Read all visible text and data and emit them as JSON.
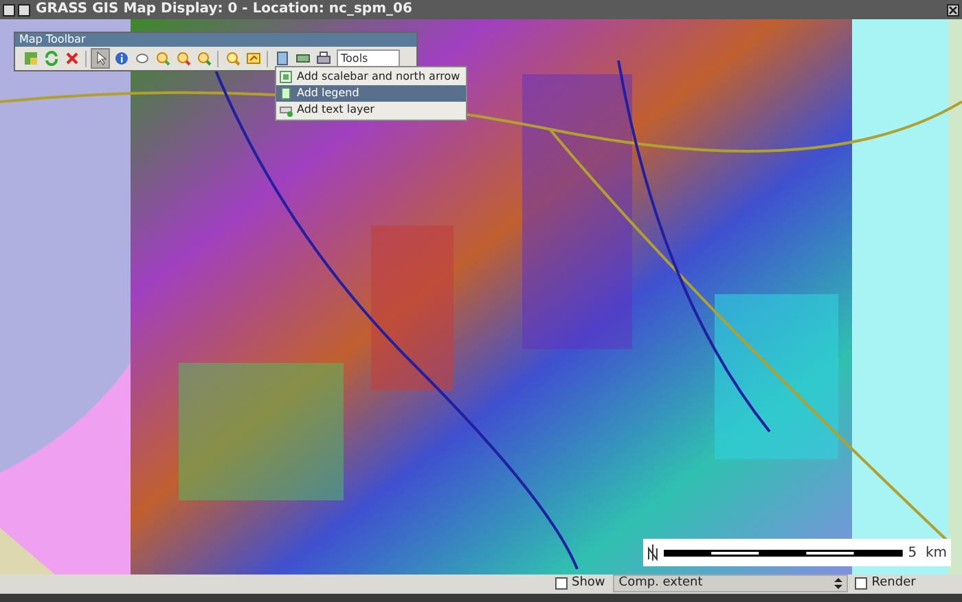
{
  "window": {
    "title": "GRASS GIS Map Display: 0 - Location: nc_spm_06"
  },
  "toolbar": {
    "title": "Map Toolbar",
    "tools": [
      {
        "kind": "add-map",
        "selected": false
      },
      {
        "kind": "rerender",
        "selected": false
      },
      {
        "kind": "erase",
        "selected": false
      },
      {
        "kind": "pointer",
        "selected": true
      },
      {
        "kind": "query",
        "selected": false
      },
      {
        "kind": "pan",
        "selected": false
      },
      {
        "kind": "zoom-in",
        "selected": false
      },
      {
        "kind": "zoom-out",
        "selected": false
      },
      {
        "kind": "zoom-back",
        "selected": false
      },
      {
        "kind": "zoom-menu",
        "selected": false
      },
      {
        "kind": "save",
        "selected": false
      },
      {
        "kind": "decoration",
        "selected": false
      },
      {
        "kind": "analyze",
        "selected": false
      },
      {
        "kind": "print",
        "selected": false
      }
    ],
    "dropdown": {
      "value": "Tools"
    }
  },
  "menu": {
    "items": [
      {
        "label": "Add scalebar and north arrow",
        "kind": "scalebar",
        "selected": false
      },
      {
        "label": "Add legend",
        "kind": "legend",
        "selected": true
      },
      {
        "label": "Add text layer",
        "kind": "text",
        "selected": false
      }
    ]
  },
  "scalebar": {
    "label": "5  km"
  },
  "status_bar": {
    "show": {
      "label": "Show",
      "checked": false
    },
    "extent": {
      "value": "Comp. extent"
    },
    "render": {
      "label": "Render",
      "checked": false
    }
  }
}
